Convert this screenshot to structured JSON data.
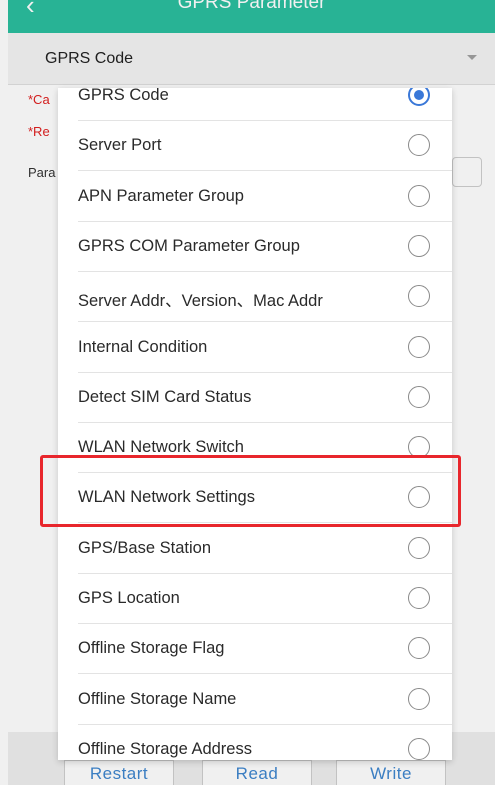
{
  "header": {
    "title": "GPRS Parameter",
    "back_glyph": "‹"
  },
  "select": {
    "current": "GPRS Code"
  },
  "background": {
    "line1": "*Ca",
    "line2": "*Re",
    "line3": "Para"
  },
  "buttons": {
    "restart": "Restart",
    "read": "Read",
    "write": "Write"
  },
  "options": [
    {
      "label": "GPRS Code",
      "selected": true
    },
    {
      "label": "Server Port",
      "selected": false
    },
    {
      "label": "APN Parameter Group",
      "selected": false
    },
    {
      "label": "GPRS COM Parameter Group",
      "selected": false
    },
    {
      "label": "Server Addr、Version、Mac Addr",
      "selected": false
    },
    {
      "label": "Internal Condition",
      "selected": false
    },
    {
      "label": "Detect SIM Card Status",
      "selected": false
    },
    {
      "label": "WLAN Network Switch",
      "selected": false
    },
    {
      "label": "WLAN Network Settings",
      "selected": false
    },
    {
      "label": "GPS/Base Station",
      "selected": false
    },
    {
      "label": "GPS Location",
      "selected": false
    },
    {
      "label": "Offline Storage Flag",
      "selected": false
    },
    {
      "label": "Offline Storage Name",
      "selected": false
    },
    {
      "label": "Offline Storage Address",
      "selected": false
    }
  ],
  "colors": {
    "header": "#2bbf9f",
    "radio_selected": "#3a78d8",
    "highlight": "#e8262c",
    "button_text": "#3f86cf"
  }
}
